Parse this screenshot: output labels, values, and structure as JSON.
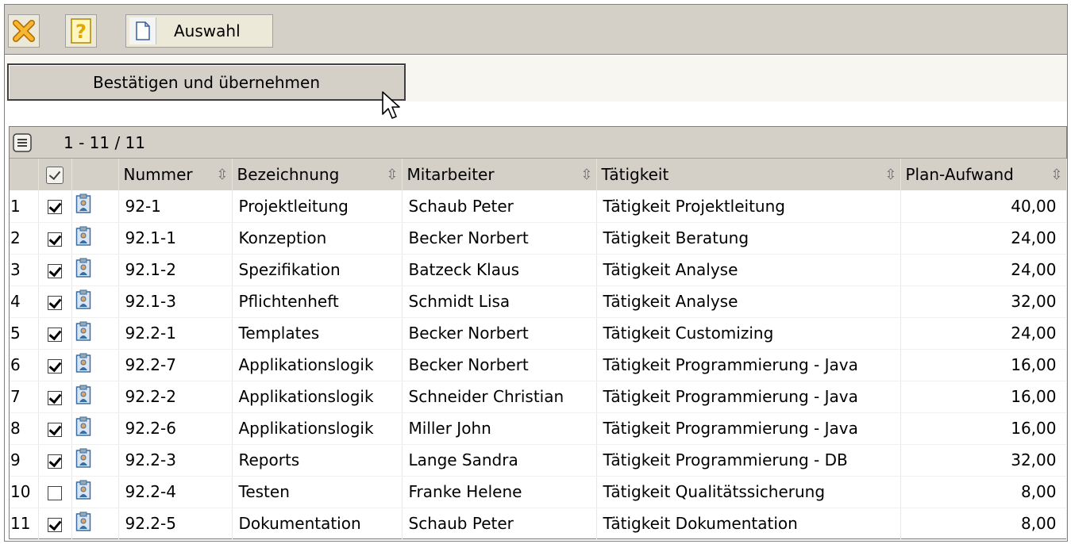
{
  "toolbar": {
    "close_icon": "close-x-icon",
    "help_icon": "help-icon",
    "help_glyph": "?",
    "auswahl_label": "Auswahl"
  },
  "action": {
    "confirm_label": "Bestätigen und übernehmen"
  },
  "grid": {
    "range_label": "1 - 11 / 11",
    "columns": [
      "Nummer",
      "Bezeichnung",
      "Mitarbeiter",
      "Tätigkeit",
      "Plan-Aufwand"
    ],
    "rows": [
      {
        "idx": "1",
        "checked": true,
        "nummer": "92-1",
        "bez": "Projektleitung",
        "mit": "Schaub Peter",
        "tat": "Tätigkeit Projektleitung",
        "plan": "40,00"
      },
      {
        "idx": "2",
        "checked": true,
        "nummer": "92.1-1",
        "bez": "Konzeption",
        "mit": "Becker Norbert",
        "tat": "Tätigkeit Beratung",
        "plan": "24,00"
      },
      {
        "idx": "3",
        "checked": true,
        "nummer": "92.1-2",
        "bez": "Spezifikation",
        "mit": "Batzeck Klaus",
        "tat": "Tätigkeit Analyse",
        "plan": "24,00"
      },
      {
        "idx": "4",
        "checked": true,
        "nummer": "92.1-3",
        "bez": "Pflichtenheft",
        "mit": "Schmidt Lisa",
        "tat": "Tätigkeit Analyse",
        "plan": "32,00"
      },
      {
        "idx": "5",
        "checked": true,
        "nummer": "92.2-1",
        "bez": "Templates",
        "mit": "Becker Norbert",
        "tat": "Tätigkeit Customizing",
        "plan": "24,00"
      },
      {
        "idx": "6",
        "checked": true,
        "nummer": "92.2-7",
        "bez": "Applikationslogik",
        "mit": "Becker Norbert",
        "tat": "Tätigkeit Programmierung - Java",
        "plan": "16,00"
      },
      {
        "idx": "7",
        "checked": true,
        "nummer": "92.2-2",
        "bez": "Applikationslogik",
        "mit": "Schneider Christian",
        "tat": "Tätigkeit Programmierung - Java",
        "plan": "16,00"
      },
      {
        "idx": "8",
        "checked": true,
        "nummer": "92.2-6",
        "bez": "Applikationslogik",
        "mit": "Miller John",
        "tat": "Tätigkeit Programmierung - Java",
        "plan": "16,00"
      },
      {
        "idx": "9",
        "checked": true,
        "nummer": "92.2-3",
        "bez": "Reports",
        "mit": "Lange Sandra",
        "tat": "Tätigkeit Programmierung - DB",
        "plan": "32,00"
      },
      {
        "idx": "10",
        "checked": false,
        "nummer": "92.2-4",
        "bez": "Testen",
        "mit": "Franke Helene",
        "tat": "Tätigkeit Qualitätssicherung",
        "plan": "8,00"
      },
      {
        "idx": "11",
        "checked": true,
        "nummer": "92.2-5",
        "bez": "Dokumentation",
        "mit": "Schaub Peter",
        "tat": "Tätigkeit Dokumentation",
        "plan": "8,00"
      }
    ]
  },
  "colors": {
    "toolbar_bg": "#d4d0c8",
    "close_orange": "#f5a623",
    "help_yellow": "#f2c200",
    "clipboard_blue": "#3a6ea5"
  }
}
